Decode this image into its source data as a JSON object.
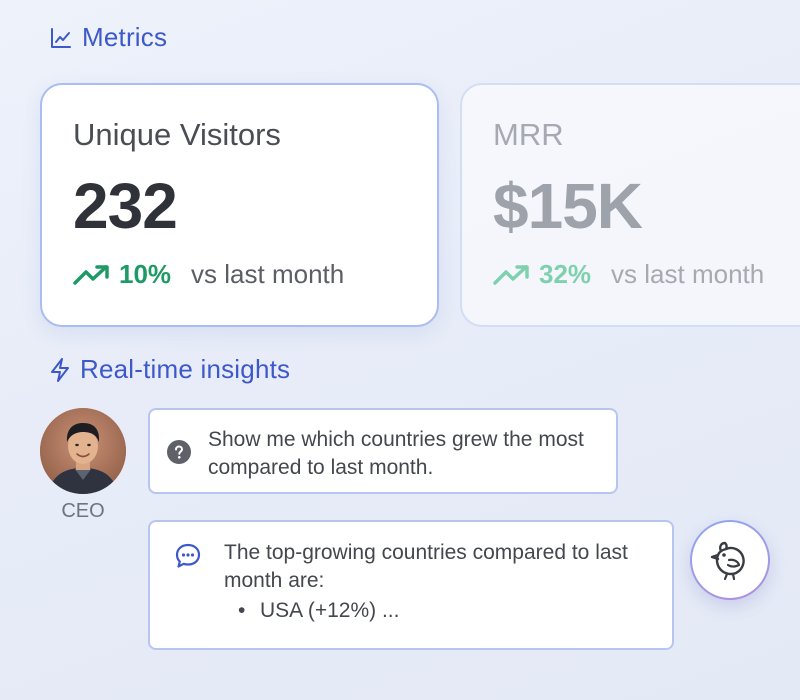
{
  "metrics": {
    "header_label": "Metrics",
    "header_icon": "line-chart-icon",
    "cards": [
      {
        "title": "Unique Visitors",
        "value": "232",
        "change_pct": "10%",
        "change_suffix": "vs last month",
        "trend_icon": "trending-up-icon"
      },
      {
        "title": "MRR",
        "value": "$15K",
        "change_pct": "32%",
        "change_suffix": "vs last month",
        "trend_icon": "trending-up-icon"
      }
    ]
  },
  "insights": {
    "header_label": "Real-time insights",
    "header_icon": "lightning-icon",
    "user": {
      "label": "CEO",
      "avatar": "user-photo"
    },
    "question": {
      "icon": "question-icon",
      "text": "Show me which countries grew the most compared to last month."
    },
    "answer": {
      "icon": "chat-bubble-icon",
      "intro": "The top-growing countries compared to last month are:",
      "items": [
        "USA (+12%) ..."
      ]
    },
    "assistant_avatar": "bird-logo-icon"
  },
  "colors": {
    "accent": "#3d59c9",
    "positive": "#1f9a66",
    "card_border": "#a9bdf2",
    "background": "#e9eef9"
  }
}
